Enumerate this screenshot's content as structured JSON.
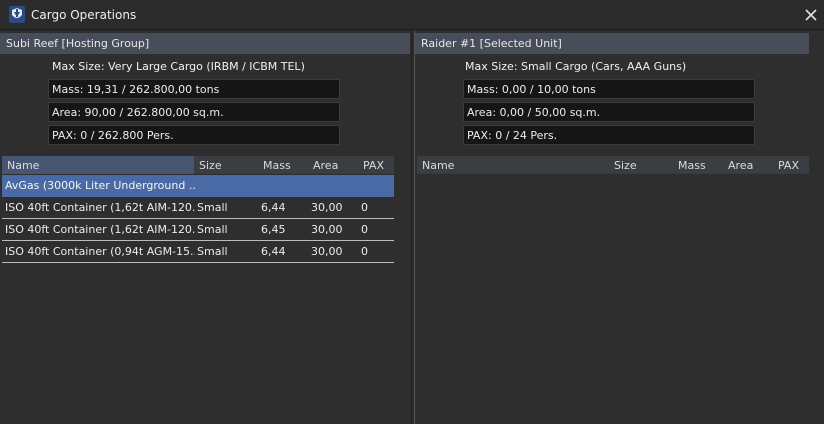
{
  "window": {
    "title": "Cargo Operations",
    "app_icon": "naval-emblem-icon",
    "close_icon": "close-icon"
  },
  "left_panel": {
    "header": "Subi Reef [Hosting Group]",
    "max_size": "Max Size: Very Large Cargo (IRBM / ICBM TEL)",
    "mass": "Mass: 19,31 / 262.800,00 tons",
    "area": "Area: 90,00 / 262.800,00 sq.m.",
    "pax": "PAX: 0 / 262.800 Pers.",
    "columns": [
      "Name",
      "Size",
      "Mass",
      "Area",
      "PAX"
    ],
    "rows": [
      {
        "name": "AvGas (3000k Liter Underground ...",
        "size": "",
        "mass": "",
        "area": "",
        "pax": "",
        "selected": true
      },
      {
        "name": "ISO 40ft Container (1,62t AIM-120...",
        "size": "Small",
        "mass": "6,44",
        "area": "30,00",
        "pax": "0",
        "selected": false
      },
      {
        "name": "ISO 40ft Container (1,62t AIM-120...",
        "size": "Small",
        "mass": "6,45",
        "area": "30,00",
        "pax": "0",
        "selected": false
      },
      {
        "name": "ISO 40ft Container (0,94t AGM-15...",
        "size": "Small",
        "mass": "6,44",
        "area": "30,00",
        "pax": "0",
        "selected": false
      }
    ]
  },
  "right_panel": {
    "header": "Raider #1 [Selected Unit]",
    "max_size": "Max Size: Small Cargo (Cars, AAA Guns)",
    "mass": "Mass: 0,00 / 10,00 tons",
    "area": "Area: 0,00 / 50,00 sq.m.",
    "pax": "PAX: 0 / 24 Pers.",
    "columns": [
      "Name",
      "Size",
      "Mass",
      "Area",
      "PAX"
    ]
  }
}
